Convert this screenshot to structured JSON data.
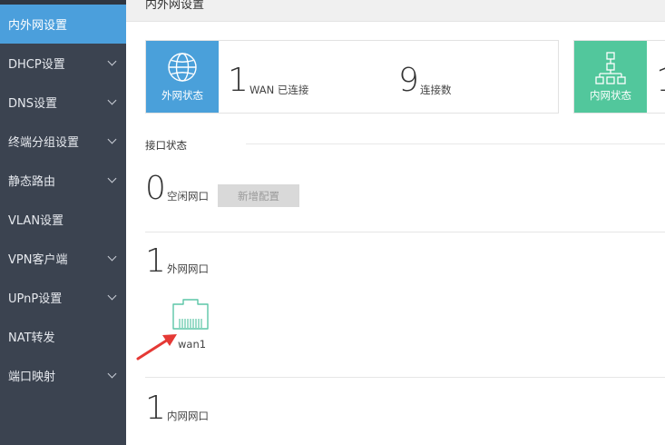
{
  "sidebar": {
    "items": [
      {
        "label": "内外网设置",
        "active": true,
        "has_submenu": false
      },
      {
        "label": "DHCP设置",
        "active": false,
        "has_submenu": true
      },
      {
        "label": "DNS设置",
        "active": false,
        "has_submenu": true
      },
      {
        "label": "终端分组设置",
        "active": false,
        "has_submenu": true
      },
      {
        "label": "静态路由",
        "active": false,
        "has_submenu": true
      },
      {
        "label": "VLAN设置",
        "active": false,
        "has_submenu": false
      },
      {
        "label": "VPN客户端",
        "active": false,
        "has_submenu": true
      },
      {
        "label": "UPnP设置",
        "active": false,
        "has_submenu": true
      },
      {
        "label": "NAT转发",
        "active": false,
        "has_submenu": false
      },
      {
        "label": "端口映射",
        "active": false,
        "has_submenu": true
      }
    ]
  },
  "header": {
    "title": "内外网设置"
  },
  "wan_card": {
    "icon": "globe-icon",
    "label": "外网状态",
    "connected_count": "1",
    "connected_label": "WAN 已连接",
    "connections_count": "9",
    "connections_label": "连接数"
  },
  "lan_card": {
    "icon": "network-tree-icon",
    "label": "内网状态",
    "count": "1"
  },
  "interface_status": {
    "title": "接口状态",
    "idle": {
      "count": "0",
      "label": "空闲网口",
      "add_button": "新增配置"
    },
    "wan": {
      "count": "1",
      "label": "外网网口",
      "ports": [
        {
          "name": "wan1"
        }
      ]
    },
    "lan": {
      "count": "1",
      "label": "内网网口"
    }
  },
  "colors": {
    "sidebar_bg": "#3b4350",
    "active_item": "#4b9fdc",
    "wan_card": "#4aa0da",
    "lan_card": "#52c79c",
    "port_icon": "#5cc6a7",
    "arrow": "#e53935"
  }
}
